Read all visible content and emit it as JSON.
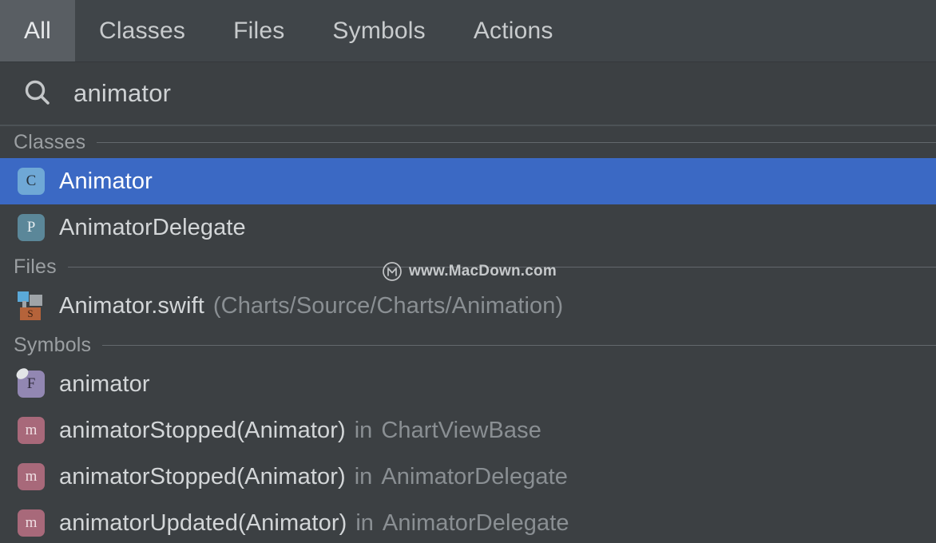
{
  "tabs": [
    {
      "label": "All",
      "active": true
    },
    {
      "label": "Classes",
      "active": false
    },
    {
      "label": "Files",
      "active": false
    },
    {
      "label": "Symbols",
      "active": false
    },
    {
      "label": "Actions",
      "active": false
    }
  ],
  "search": {
    "icon": "search-icon",
    "value": "animator",
    "placeholder": "animator"
  },
  "sections": [
    {
      "title": "Classes",
      "rows": [
        {
          "icon": "class-badge",
          "badge": "C",
          "label": "Animator",
          "sub": "",
          "in": "",
          "selected": true
        },
        {
          "icon": "protocol-badge",
          "badge": "P",
          "label": "AnimatorDelegate",
          "sub": "",
          "in": "",
          "selected": false
        }
      ]
    },
    {
      "title": "Files",
      "rows": [
        {
          "icon": "swift-file-icon",
          "badge": "S",
          "label": "Animator.swift",
          "sub": "(Charts/Source/Charts/Animation)",
          "in": "",
          "selected": false
        }
      ]
    },
    {
      "title": "Symbols",
      "rows": [
        {
          "icon": "field-badge",
          "badge": "F",
          "label": "animator",
          "sub": "",
          "in": "",
          "selected": false
        },
        {
          "icon": "method-badge",
          "badge": "m",
          "label": "animatorStopped(Animator)",
          "sub": "ChartViewBase",
          "in": "in",
          "selected": false
        },
        {
          "icon": "method-badge",
          "badge": "m",
          "label": "animatorStopped(Animator)",
          "sub": "AnimatorDelegate",
          "in": "in",
          "selected": false
        },
        {
          "icon": "method-badge",
          "badge": "m",
          "label": "animatorUpdated(Animator)",
          "sub": "AnimatorDelegate",
          "in": "in",
          "selected": false
        }
      ]
    }
  ],
  "watermark": {
    "icon": "macdown-logo-icon",
    "text": "www.MacDown.com"
  },
  "colors": {
    "background": "#3c4043",
    "tabbar": "#404549",
    "tab_active": "#595e63",
    "selection": "#3b69c4",
    "text_primary": "#d3d6d8",
    "text_secondary": "#8a8f93",
    "divider": "#63686c",
    "badge_class": "#6fa8d6",
    "badge_protocol": "#5b8799",
    "badge_field": "#9287b2",
    "badge_method": "#a8697a",
    "badge_swift": "#b5633a"
  }
}
